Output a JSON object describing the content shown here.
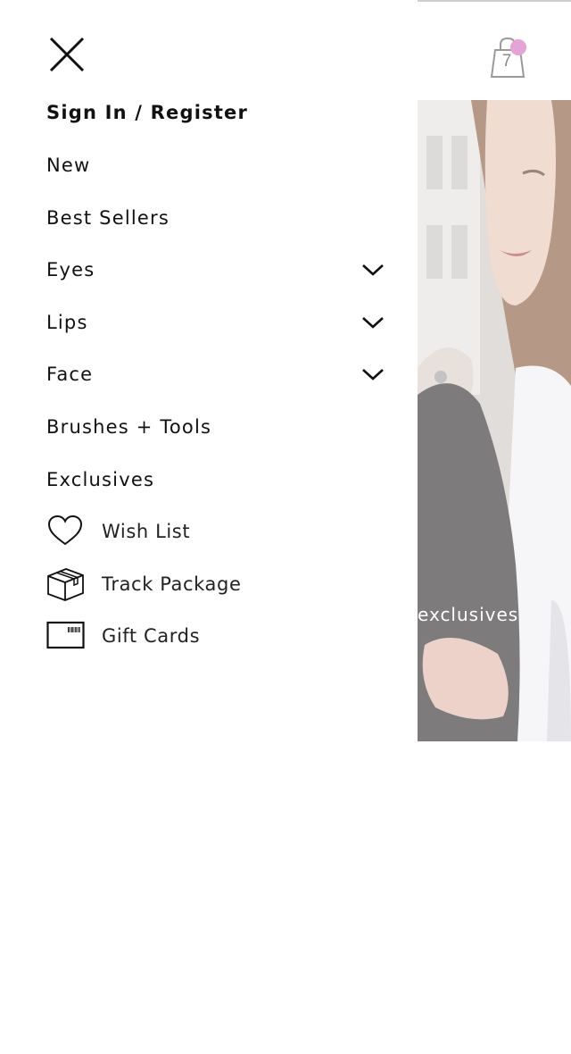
{
  "drawer": {
    "sign_in": "Sign In / Register",
    "categories": [
      {
        "label": "New",
        "expandable": false
      },
      {
        "label": "Best Sellers",
        "expandable": false
      },
      {
        "label": "Eyes",
        "expandable": true
      },
      {
        "label": "Lips",
        "expandable": true
      },
      {
        "label": "Face",
        "expandable": true
      },
      {
        "label": "Brushes + Tools",
        "expandable": false
      },
      {
        "label": "Exclusives",
        "expandable": false
      }
    ],
    "utilities": [
      {
        "label": "Wish List",
        "icon": "heart-icon"
      },
      {
        "label": "Track Package",
        "icon": "package-icon"
      },
      {
        "label": "Gift Cards",
        "icon": "gift-card-icon"
      }
    ]
  },
  "header": {
    "bag_count": "7",
    "bag_badge_color": "#e8a3d6"
  },
  "hero": {
    "caption": "exclusives"
  }
}
